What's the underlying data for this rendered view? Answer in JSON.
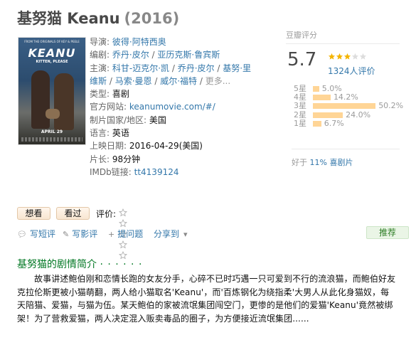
{
  "movie": {
    "title": "基努猫 Keanu",
    "year": "(2016)"
  },
  "poster": {
    "tagline": "FROM THE ORIGINALS OF KEY & PEELE",
    "logo_text": "KEANU",
    "subtitle": "KITTEN, PLEASE",
    "date_text": "APRIL 29"
  },
  "info": {
    "director_label": "导演:",
    "director": "彼得·阿特西奥",
    "writers_label": "编剧:",
    "writers": [
      "乔丹·皮尔",
      "亚历克斯·鲁宾斯"
    ],
    "cast_label": "主演:",
    "cast": [
      "科甘-迈克尔·凯",
      "乔丹·皮尔",
      "基努·里维斯",
      "马索·曼恩",
      "威尔·福特"
    ],
    "more": "更多...",
    "genre_label": "类型:",
    "genre": "喜剧",
    "site_label": "官方网站:",
    "site": "keanumovie.com/#/",
    "country_label": "制片国家/地区:",
    "country": "美国",
    "language_label": "语言:",
    "language": "英语",
    "release_label": "上映日期:",
    "release": "2016-04-29(美国)",
    "runtime_label": "片长:",
    "runtime": "98分钟",
    "imdb_label": "IMDb链接:",
    "imdb": "tt4139124",
    "sep": " / "
  },
  "rating": {
    "header": "豆瓣评分",
    "score": "5.7",
    "stars_filled": 3,
    "count_text": "1324人评价",
    "bars": [
      {
        "label": "5星",
        "percent": 5.0,
        "text": "5.0%"
      },
      {
        "label": "4星",
        "percent": 14.2,
        "text": "14.2%"
      },
      {
        "label": "3星",
        "percent": 50.2,
        "text": "50.2%"
      },
      {
        "label": "2星",
        "percent": 24.0,
        "text": "24.0%"
      },
      {
        "label": "1星",
        "percent": 6.7,
        "text": "6.7%"
      }
    ],
    "better_prefix": "好于 ",
    "better_link": "11% 喜剧片"
  },
  "actions": {
    "want": "想看",
    "seen": "看过",
    "rate_label": "评价:"
  },
  "tools": {
    "short_review": "写短评",
    "review": "写影评",
    "question": "提问题",
    "share": "分享到",
    "recommend": "推荐"
  },
  "synopsis": {
    "title": "基努猫的剧情简介",
    "dots": "· · · · · ·",
    "body": "故事讲述鲍伯刚和恋情长跑的女友分手，心碎不已时巧遇一只可爱到不行的流浪猫，而鲍伯好友克拉伦斯更被小猫萌翻，两人给小猫取名'Keanu'，而'百炼钢化为绕指柔'大男人从此化身猫奴，每天陪猫、爱猫，与猫为伍。某天鲍伯的家被流氓集团闯空门，更惨的是他们的爱猫'Keanu'竟然被绑架！为了营救爱猫，两人决定混入贩卖毒品的圈子，为方便接近流氓集团......"
  },
  "colors": {
    "link": "#3377aa",
    "bar": "#ffd596",
    "star": "#f4b400",
    "green": "#007722"
  }
}
